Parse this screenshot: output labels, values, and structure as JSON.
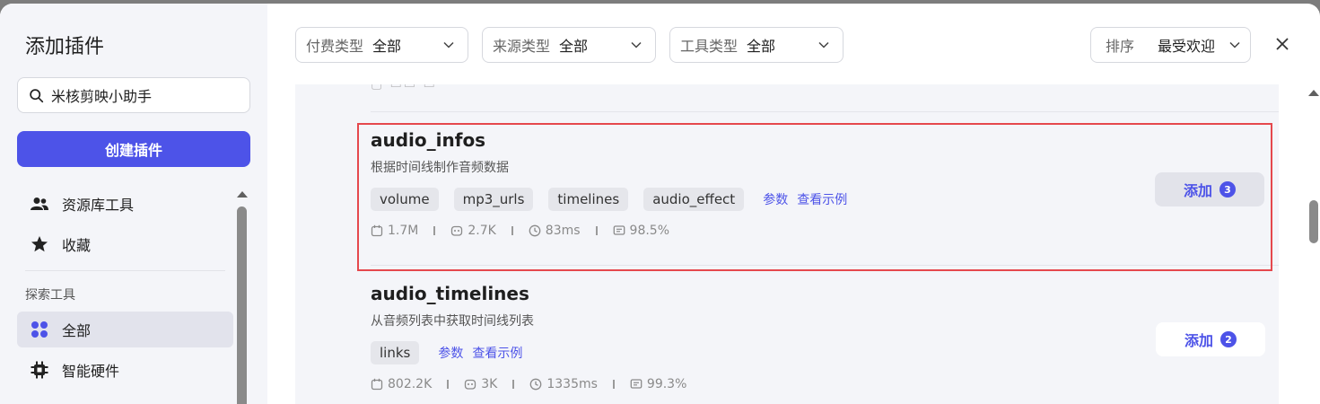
{
  "sidebar": {
    "title": "添加插件",
    "search_value": "米核剪映小助手",
    "create_label": "创建插件",
    "top_items": [
      {
        "label": "资源库工具",
        "icon": "users-icon"
      },
      {
        "label": "收藏",
        "icon": "star-icon"
      }
    ],
    "section_label": "探索工具",
    "explore_items": [
      {
        "label": "全部",
        "icon": "grid-icon",
        "active": true
      },
      {
        "label": "智能硬件",
        "icon": "chip-icon",
        "active": false
      }
    ]
  },
  "filters": [
    {
      "label": "付费类型",
      "value": "全部"
    },
    {
      "label": "来源类型",
      "value": "全部"
    },
    {
      "label": "工具类型",
      "value": "全部"
    }
  ],
  "sort": {
    "label": "排序",
    "value": "最受欢迎"
  },
  "accent_color": "#4d53e8",
  "highlight_color": "#e5484d",
  "items": [
    {
      "name": "audio_infos",
      "description": "根据时间线制作音频数据",
      "tags": [
        "volume",
        "mp3_urls",
        "timelines",
        "audio_effect"
      ],
      "links": [
        "参数",
        "查看示例"
      ],
      "stats": {
        "uses": "1.7M",
        "bots": "2.7K",
        "latency": "83ms",
        "success": "98.5%"
      },
      "add_label": "添加",
      "add_count": "3"
    },
    {
      "name": "audio_timelines",
      "description": "从音频列表中获取时间线列表",
      "tags": [
        "links"
      ],
      "links": [
        "参数",
        "查看示例"
      ],
      "stats": {
        "uses": "802.2K",
        "bots": "3K",
        "latency": "1335ms",
        "success": "99.3%"
      },
      "add_label": "添加",
      "add_count": "2"
    }
  ]
}
